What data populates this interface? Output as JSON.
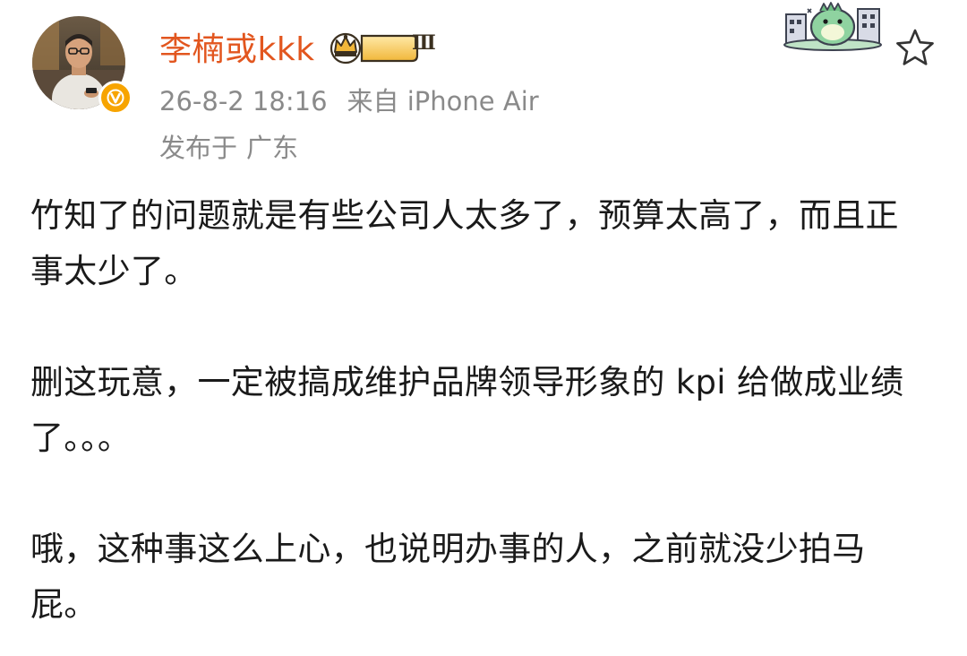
{
  "user": {
    "name": "李楠或kkk",
    "vip_level": "Ⅲ"
  },
  "meta": {
    "time": "26-8-2 18:16",
    "source": "来自 iPhone Air",
    "location_prefix": "发布于",
    "location": "广东"
  },
  "paragraphs": [
    "竹知了的问题就是有些公司人太多了，预算太高了，而且正事太少了。",
    "删这玩意，一定被搞成维护品牌领导形象的 kpi 给做成业绩了。。。",
    "哦，这种事这么上心，也说明办事的人，之前就没少拍马屁。"
  ],
  "colors": {
    "username": "#e2561f",
    "meta": "#8a8a8a",
    "verified": "#f7a400",
    "body_text": "#1a1a1a"
  },
  "icons": {
    "star": "star-outline",
    "verified": "verified-v-badge",
    "vip": "crown-badge"
  }
}
